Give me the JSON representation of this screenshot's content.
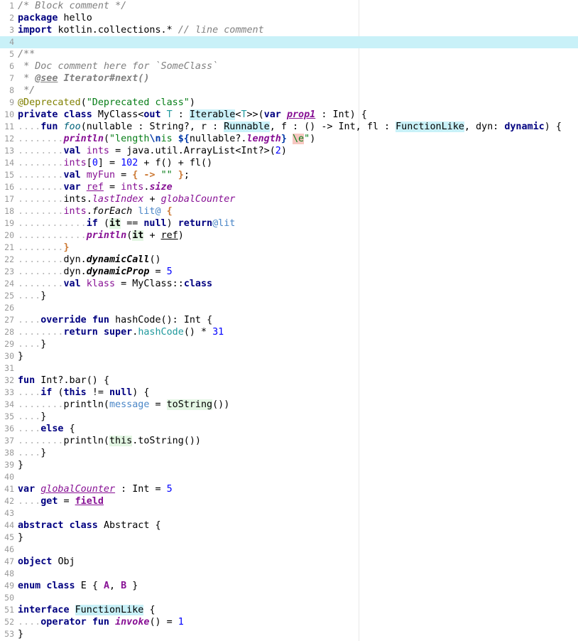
{
  "editor": {
    "current_line": 4,
    "lines": [
      {
        "n": "1",
        "html": "<span class=\"cm\">/*<span class=\"ws\"> </span>Block<span class=\"ws\"> </span>comment<span class=\"ws\"> </span>*/</span>"
      },
      {
        "n": "2",
        "html": "<span class=\"kw\">package</span><span class=\"ws\"> </span>hello"
      },
      {
        "n": "3",
        "html": "<span class=\"kw\">import</span><span class=\"ws\"> </span>kotlin.collections.*<span class=\"ws\"> </span><span class=\"cm\">//<span class=\"ws\"> </span>line<span class=\"ws\"> </span>comment</span>"
      },
      {
        "n": "4",
        "html": ""
      },
      {
        "n": "5",
        "html": "<span class=\"cm\">/**</span>"
      },
      {
        "n": "6",
        "html": "<span class=\"cm\"><span class=\"ws\"> </span>*<span class=\"ws\"> </span>Doc<span class=\"ws\"> </span>comment<span class=\"ws\"> </span>here<span class=\"ws\"> </span>for<span class=\"ws\"> </span>`SomeClass`</span>"
      },
      {
        "n": "7",
        "html": "<span class=\"cm\"><span class=\"ws\"> </span>*<span class=\"ws\"> </span><span style=\"text-decoration:underline;font-weight:bold\">@see</span><span class=\"ws\"> </span><b>Iterator#next()</b></span>"
      },
      {
        "n": "8",
        "html": "<span class=\"cm\"><span class=\"ws\"> </span>*/</span>"
      },
      {
        "n": "9",
        "html": "<span class=\"anno\">@Deprecated</span>(<span class=\"str\">\"Deprecated<span class=\"ws\"> </span>class\"</span>)"
      },
      {
        "n": "10",
        "html": "<span class=\"kw\">private</span><span class=\"ws\"> </span><span class=\"kw\">class</span><span class=\"ws\"> </span>MyClass&lt;<span class=\"kw\">out</span><span class=\"ws\"> </span><span class=\"typep\">T</span><span class=\"ws\"> </span>:<span class=\"ws\"> </span><span class=\"hl\">Iterable</span>&lt;<span class=\"typep\">T</span>&gt;&gt;(<span class=\"kw\">var</span><span class=\"ws\"> </span><span class=\"mparam\">prop1</span><span class=\"ws\"> </span>:<span class=\"ws\"> </span>Int)<span class=\"ws\"> </span>{"
      },
      {
        "n": "11",
        "html": "<span class=\"ws\">....</span><span class=\"kw\">fun</span><span class=\"ws\"> </span><span class=\"fn\" style=\"color:#00627a\">foo</span>(nullable<span class=\"ws\"> </span>:<span class=\"ws\"> </span>String?,<span class=\"ws\"> </span>r<span class=\"ws\"> </span>:<span class=\"ws\"> </span><span class=\"hl\">Runnable</span>,<span class=\"ws\"> </span>f<span class=\"ws\"> </span>:<span class=\"ws\"> </span>()<span class=\"ws\"> </span>-&gt;<span class=\"ws\"> </span>Int,<span class=\"ws\"> </span>fl<span class=\"ws\"> </span>:<span class=\"ws\"> </span><span class=\"hl\">FunctionLike</span>,<span class=\"ws\"> </span>dyn:<span class=\"ws\"> </span><span class=\"kw\">dynamic</span>)<span class=\"ws\"> </span>{"
      },
      {
        "n": "12",
        "html": "<span class=\"ws\">........</span><span class=\"sm\" style=\"color:#871094\">println</span>(<span class=\"str\">\"length<span class=\"esc\">\\n</span>is<span class=\"ws\"> </span></span><span class=\"esc\">${</span>nullable?.<span class=\"sm\" style=\"color:#871094\">length</span><span class=\"esc\">}</span><span class=\"ws\"> </span><span class=\"badesc str\">\\e</span><span class=\"str\">\"</span>)"
      },
      {
        "n": "13",
        "html": "<span class=\"ws\">........</span><span class=\"kw\">val</span><span class=\"ws\"> </span><span class=\"field\">ints</span><span class=\"ws\"> </span>=<span class=\"ws\"> </span>java.util.ArrayList&lt;Int?&gt;(<span class=\"num\">2</span>)"
      },
      {
        "n": "14",
        "html": "<span class=\"ws\">........</span><span class=\"field\">ints</span>[<span class=\"num\">0</span>]<span class=\"ws\"> </span>=<span class=\"ws\"> </span><span class=\"num\">102</span><span class=\"ws\"> </span>+<span class=\"ws\"> </span>f()<span class=\"ws\"> </span>+<span class=\"ws\"> </span>fl()"
      },
      {
        "n": "15",
        "html": "<span class=\"ws\">........</span><span class=\"kw\">val</span><span class=\"ws\"> </span><span class=\"field\">myFun</span><span class=\"ws\"> </span>=<span class=\"ws\"> </span><span class=\"orange\">{</span><span class=\"ws\"> </span><span class=\"orange\">-&gt;</span><span class=\"ws\"> </span><span class=\"str\">\"\"</span><span class=\"ws\"> </span><span class=\"orange\">}</span>;"
      },
      {
        "n": "16",
        "html": "<span class=\"ws\">........</span><span class=\"kw\">var</span><span class=\"ws\"> </span><span class=\"field lvar\">ref</span><span class=\"ws\"> </span>=<span class=\"ws\"> </span><span class=\"field\">ints</span>.<span class=\"sm\" style=\"color:#871094\">size</span>"
      },
      {
        "n": "17",
        "html": "<span class=\"ws\">........</span>ints.<span class=\"ifield\">lastIndex</span><span class=\"ws\"> </span>+<span class=\"ws\"> </span><span class=\"ifield\">globalCounter</span>"
      },
      {
        "n": "18",
        "html": "<span class=\"ws\">........</span><span class=\"field\">ints</span>.<span class=\"ext\">forEach</span><span class=\"ws\"> </span><span class=\"label\">lit@</span><span class=\"ws\"> </span><span class=\"orange\">{</span>"
      },
      {
        "n": "19",
        "html": "<span class=\"ws\">............</span><span class=\"kw\">if</span><span class=\"ws\"> </span>(<span class=\"itb\">it</span><span class=\"ws\"> </span>==<span class=\"ws\"> </span><span class=\"kw\">null</span>)<span class=\"ws\"> </span><span class=\"kw\">return</span><span class=\"label\">@lit</span>"
      },
      {
        "n": "20",
        "html": "<span class=\"ws\">............</span><span class=\"sm\" style=\"color:#871094\">println</span>(<span class=\"itb\">it</span><span class=\"ws\"> </span>+<span class=\"ws\"> </span><span class=\"lvar\">ref</span>)"
      },
      {
        "n": "21",
        "html": "<span class=\"ws\">........</span><span class=\"orange\">}</span>"
      },
      {
        "n": "22",
        "html": "<span class=\"ws\">........</span>dyn.<span class=\"extb\">dynamicCall</span>()"
      },
      {
        "n": "23",
        "html": "<span class=\"ws\">........</span>dyn.<span class=\"extb\">dynamicProp</span><span class=\"ws\"> </span>=<span class=\"ws\"> </span><span class=\"num\">5</span>"
      },
      {
        "n": "24",
        "html": "<span class=\"ws\">........</span><span class=\"kw\">val</span><span class=\"ws\"> </span><span class=\"field\">klass</span><span class=\"ws\"> </span>=<span class=\"ws\"> </span>MyClass::<span class=\"kw\">class</span>"
      },
      {
        "n": "25",
        "html": "<span class=\"ws\">....</span>}"
      },
      {
        "n": "26",
        "html": ""
      },
      {
        "n": "27",
        "html": "<span class=\"ws\">....</span><span class=\"kw\">override</span><span class=\"ws\"> </span><span class=\"kw\">fun</span><span class=\"ws\"> </span>hashCode():<span class=\"ws\"> </span>Int<span class=\"ws\"> </span>{"
      },
      {
        "n": "28",
        "html": "<span class=\"ws\">........</span><span class=\"kw\">return</span><span class=\"ws\"> </span><span class=\"kw\">super</span>.<span class=\"typep\">hashCode</span>()<span class=\"ws\"> </span>*<span class=\"ws\"> </span><span class=\"num\">31</span>"
      },
      {
        "n": "29",
        "html": "<span class=\"ws\">....</span>}"
      },
      {
        "n": "30",
        "html": "}"
      },
      {
        "n": "31",
        "html": ""
      },
      {
        "n": "32",
        "html": "<span class=\"kw\">fun</span><span class=\"ws\"> </span>Int?.bar()<span class=\"ws\"> </span>{"
      },
      {
        "n": "33",
        "html": "<span class=\"ws\">....</span><span class=\"kw\">if</span><span class=\"ws\"> </span>(<span class=\"kw\">this</span><span class=\"ws\"> </span>!=<span class=\"ws\"> </span><span class=\"kw\">null</span>)<span class=\"ws\"> </span>{"
      },
      {
        "n": "34",
        "html": "<span class=\"ws\">........</span>println(<span class=\"named\">message</span><span class=\"ws\"> </span>=<span class=\"ws\"> </span><span style=\"background:#e3f6e3\">toString</span>())"
      },
      {
        "n": "35",
        "html": "<span class=\"ws\">....</span>}"
      },
      {
        "n": "36",
        "html": "<span class=\"ws\">....</span><span class=\"kw\">else</span><span class=\"ws\"> </span>{"
      },
      {
        "n": "37",
        "html": "<span class=\"ws\">........</span>println(<span style=\"background:#e3f6e3\">this</span>.toString())"
      },
      {
        "n": "38",
        "html": "<span class=\"ws\">....</span>}"
      },
      {
        "n": "39",
        "html": "}"
      },
      {
        "n": "40",
        "html": ""
      },
      {
        "n": "41",
        "html": "<span class=\"kw\">var</span><span class=\"ws\"> </span><span class=\"gvar\">globalCounter</span><span class=\"ws\"> </span>:<span class=\"ws\"> </span>Int<span class=\"ws\"> </span>=<span class=\"ws\"> </span><span class=\"num\">5</span>"
      },
      {
        "n": "42",
        "html": "<span class=\"ws\">....</span><span class=\"kw\">get</span><span class=\"ws\"> </span>=<span class=\"ws\"> </span><span class=\"ufield\">field</span>"
      },
      {
        "n": "43",
        "html": ""
      },
      {
        "n": "44",
        "html": "<span class=\"kw\">abstract</span><span class=\"ws\"> </span><span class=\"kw\">class</span><span class=\"ws\"> </span>Abstract<span class=\"ws\"> </span>{"
      },
      {
        "n": "45",
        "html": "}"
      },
      {
        "n": "46",
        "html": ""
      },
      {
        "n": "47",
        "html": "<span class=\"kw\">object</span><span class=\"ws\"> </span>Obj"
      },
      {
        "n": "48",
        "html": ""
      },
      {
        "n": "49",
        "html": "<span class=\"kw\">enum</span><span class=\"ws\"> </span><span class=\"kw\">class</span><span class=\"ws\"> </span>E<span class=\"ws\"> </span>{<span class=\"ws\"> </span><span class=\"field\" style=\"font-weight:bold\">A</span>,<span class=\"ws\"> </span><span class=\"field\" style=\"font-weight:bold\">B</span><span class=\"ws\"> </span>}"
      },
      {
        "n": "50",
        "html": ""
      },
      {
        "n": "51",
        "html": "<span class=\"kw\">interface</span><span class=\"ws\"> </span><span class=\"hl\">FunctionLike</span><span class=\"ws\"> </span>{"
      },
      {
        "n": "52",
        "html": "<span class=\"ws\">....</span><span class=\"kw\">operator</span><span class=\"ws\"> </span><span class=\"kw\">fun</span><span class=\"ws\"> </span><span class=\"sm\" style=\"color:#871094\">invoke</span>()<span class=\"ws\"> </span>=<span class=\"ws\"> </span><span class=\"num\">1</span>"
      },
      {
        "n": "53",
        "html": "}"
      }
    ]
  }
}
